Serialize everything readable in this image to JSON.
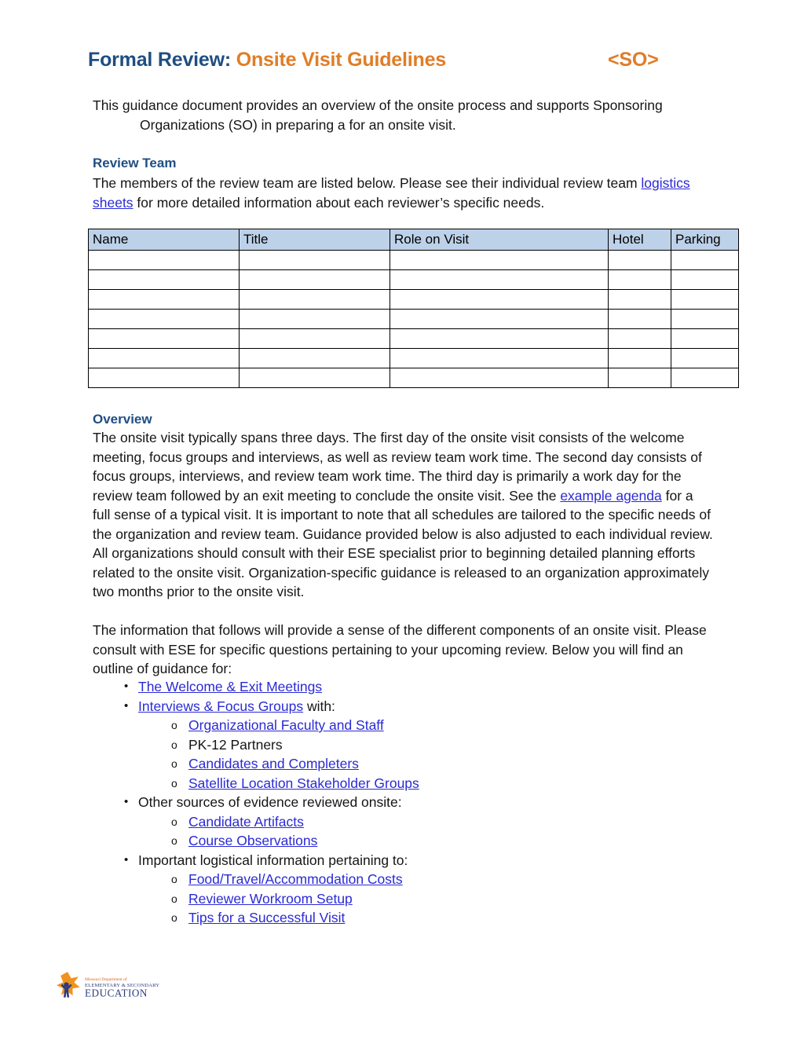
{
  "document": {
    "title_prefix": "Formal Review:",
    "title_suffix": "Onsite Visit Guidelines",
    "title_tag": "<SO>",
    "intro_line_1": "This guidance document provides an overview of the onsite process and supports Sponsoring",
    "intro_line_2": "Organizations (SO) in preparing a for an onsite visit."
  },
  "review_team": {
    "heading": "Review Team",
    "text_before_link": "The members of the review team are listed below. Please see their individual review team ",
    "link_label": "logistics sheets",
    "text_after_link": " for more detailed information about each reviewer’s specific needs.",
    "table": {
      "columns": [
        "Name",
        "Title",
        "Role on Visit",
        "Hotel",
        "Parking"
      ],
      "empty_row_count": 7,
      "header_fill": "#BDD1E9"
    }
  },
  "overview": {
    "heading": "Overview",
    "paragraph_1_before_link": "The onsite visit typically spans three days. The first day of the onsite visit consists of the welcome meeting, focus groups and interviews, as well as review team work time. The second day consists of focus groups, interviews, and review team work time. The third day is primarily a work day for the review team followed by an exit meeting to conclude the onsite visit. See the ",
    "paragraph_1_link": "example agenda",
    "paragraph_1_after_link": " for a full sense of a typical visit. It is important to note that all schedules are tailored to the specific needs of the organization and review team. Guidance provided below is also adjusted to each individual review. All organizations should consult with their ESE specialist prior to beginning detailed planning efforts related to the onsite visit. Organization-specific guidance is released to an organization approximately two months prior to the onsite visit.",
    "paragraph_2": "The information that follows will provide a sense of the different components of an onsite visit. Please consult with ESE for specific questions pertaining to your upcoming review. Below you will find an outline of guidance for:"
  },
  "outline": {
    "items": [
      {
        "level": 1,
        "marker": "•",
        "link": "The Welcome & Exit Meetings",
        "text": ""
      },
      {
        "level": 1,
        "marker": "•",
        "link": "Interviews & Focus Groups",
        "text": " with:"
      },
      {
        "level": 2,
        "marker": "o",
        "link": "Organizational Faculty and Staff",
        "text": ""
      },
      {
        "level": 2,
        "marker": "o",
        "link": "",
        "text": "PK-12 Partners"
      },
      {
        "level": 2,
        "marker": "o",
        "link": "Candidates and Completers",
        "text": ""
      },
      {
        "level": 2,
        "marker": "o",
        "link": "Satellite Location Stakeholder Groups",
        "text": ""
      },
      {
        "level": 1,
        "marker": "•",
        "link": "",
        "text": "Other sources of evidence reviewed onsite:"
      },
      {
        "level": 2,
        "marker": "o",
        "link": "Candidate Artifacts",
        "text": ""
      },
      {
        "level": 2,
        "marker": "o",
        "link": "Course Observations",
        "text": ""
      },
      {
        "level": 1,
        "marker": "•",
        "link": "",
        "text": "Important logistical information pertaining to:"
      },
      {
        "level": 2,
        "marker": "o",
        "link": "Food/Travel/Accommodation Costs",
        "text": ""
      },
      {
        "level": 2,
        "marker": "o",
        "link": "Reviewer Workroom Setup",
        "text": ""
      },
      {
        "level": 2,
        "marker": "o",
        "link": "Tips for a Successful Visit",
        "text": ""
      }
    ]
  },
  "footer": {
    "logo": {
      "name": "missouri-dese-logo",
      "line_1": "Missouri Department of",
      "line_2": "ELEMENTARY & SECONDARY",
      "line_3": "EDUCATION",
      "star_color": "#F0921E",
      "figure_color": "#2B3C7E",
      "text_color": "#2B3C7E",
      "small_text_color": "#E2601B"
    }
  },
  "colors": {
    "heading_blue": "#1F4E82",
    "accent_orange": "#E07D27",
    "link_blue": "#2A2AD6",
    "table_header": "#BDD1E9",
    "body_text": "#151515"
  }
}
